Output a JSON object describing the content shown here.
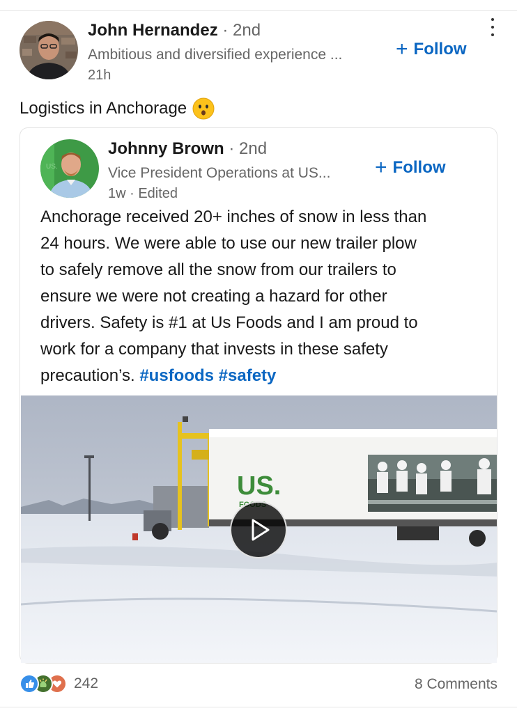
{
  "author": {
    "name": "John Hernandez",
    "degree": "· 2nd",
    "headline": "Ambitious and diversified experience ...",
    "time": "21h",
    "follow_label": "Follow"
  },
  "commentary": "Logistics in Anchorage",
  "shared_post": {
    "author": {
      "name": "Johnny Brown",
      "degree": "· 2nd",
      "headline": "Vice President Operations at US...",
      "time": "1w · Edited",
      "follow_label": "Follow"
    },
    "body_lines": [
      "Anchorage received 20+ inches of snow in less than",
      "24 hours.  We were able to use our new trailer plow",
      "to safely remove all the snow from our trailers to",
      "ensure we were not creating a hazard for other",
      "drivers.  Safety is #1 at Us Foods and I am proud to",
      "work for a company that invests in these safety",
      "precaution’s."
    ],
    "hashtags": "#usfoods #safety",
    "video": {
      "trailer_logo": "US.",
      "trailer_sub": "FOODS"
    }
  },
  "social": {
    "reaction_count": "242",
    "comments": "8 Comments",
    "reaction_icons": [
      "like-icon",
      "celebrate-icon",
      "love-icon"
    ]
  },
  "colors": {
    "accent": "#0a66c2",
    "like": "#378fe9",
    "celebrate": "#44712e",
    "love": "#df704d"
  }
}
